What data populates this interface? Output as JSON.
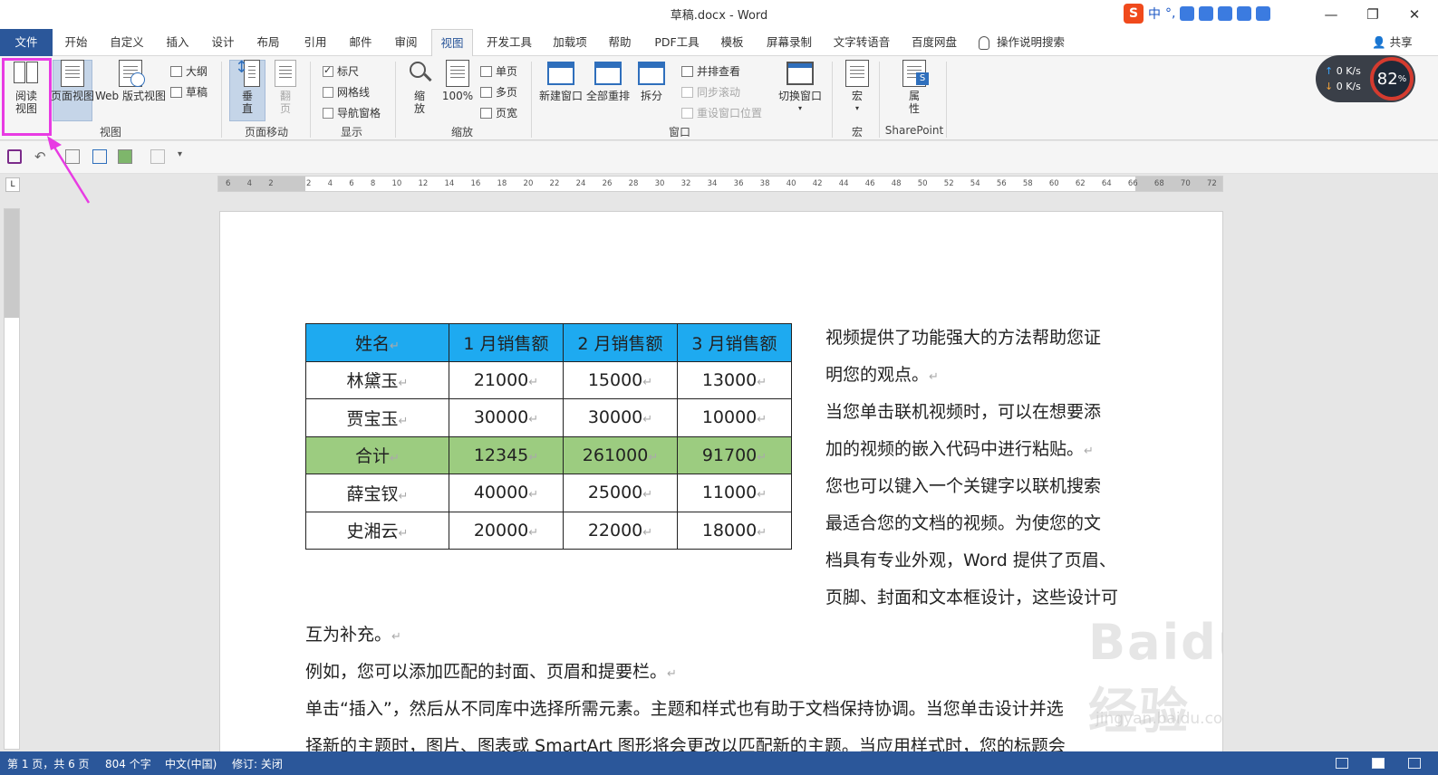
{
  "window": {
    "title": "草稿.docx  -  Word",
    "ime": {
      "logo": "S",
      "lang": "中",
      "punct": "°,"
    },
    "controls": {
      "minimize": "—",
      "restore": "❐",
      "close": "✕"
    }
  },
  "tabs": {
    "file": "文件",
    "items": [
      "开始",
      "自定义",
      "插入",
      "设计",
      "布局",
      "引用",
      "邮件",
      "审阅",
      "视图",
      "开发工具",
      "加载项",
      "帮助",
      "PDF工具",
      "模板",
      "屏幕录制",
      "文字转语音",
      "百度网盘"
    ],
    "search": "操作说明搜索",
    "share": "共享"
  },
  "ribbon": {
    "views": {
      "read_mode": "阅读视图",
      "print_layout": "页面视图",
      "web_layout": "Web 版式视图",
      "outline": "大纲",
      "draft": "草稿",
      "group": "视图"
    },
    "page_movement": {
      "vertical": "垂直",
      "side_to_side": "翻页",
      "group": "页面移动"
    },
    "show": {
      "ruler": "标尺",
      "gridlines": "网格线",
      "navigation": "导航窗格",
      "group": "显示",
      "ruler_checked": true,
      "gridlines_checked": false,
      "navigation_checked": false
    },
    "zoom": {
      "zoom": "缩放",
      "hundred": "100%",
      "one_page": "单页",
      "multiple_pages": "多页",
      "page_width": "页宽",
      "group": "缩放"
    },
    "window": {
      "new_window": "新建窗口",
      "arrange_all": "全部重排",
      "split": "拆分",
      "side_by_side": "并排查看",
      "sync_scroll": "同步滚动",
      "reset_position": "重设窗口位置",
      "switch_windows": "切换窗口",
      "group": "窗口"
    },
    "macros": {
      "macros": "宏",
      "group": "宏"
    },
    "sharepoint": {
      "properties": "属性",
      "group": "SharePoint"
    }
  },
  "speed": {
    "up": "0 K/s",
    "down": "0 K/s",
    "percent": "82",
    "percent_unit": "%"
  },
  "ruler_numbers": [
    "6",
    "4",
    "2",
    "",
    "2",
    "4",
    "6",
    "8",
    "10",
    "12",
    "14",
    "16",
    "18",
    "20",
    "22",
    "24",
    "26",
    "28",
    "30",
    "32",
    "34",
    "36",
    "38",
    "40",
    "42",
    "44",
    "46",
    "48",
    "50",
    "52",
    "54",
    "56",
    "58",
    "60",
    "62",
    "64",
    "66",
    "68",
    "70",
    "72"
  ],
  "ruler_corner": "L",
  "document": {
    "table": {
      "headers": [
        "姓名",
        "1 月销售额",
        "2 月销售额",
        "3 月销售额"
      ],
      "rows": [
        [
          "林黛玉",
          "21000",
          "15000",
          "13000"
        ],
        [
          "贾宝玉",
          "30000",
          "30000",
          "10000"
        ],
        [
          "合计",
          "12345",
          "261000",
          "91700"
        ],
        [
          "薛宝钗",
          "40000",
          "25000",
          "11000"
        ],
        [
          "史湘云",
          "20000",
          "22000",
          "18000"
        ]
      ],
      "total_row_index": 2
    },
    "side_lines": [
      "视频提供了功能强大的方法帮助您证",
      "明您的观点。",
      "当您单击联机视频时，可以在想要添",
      "加的视频的嵌入代码中进行粘贴。",
      "您也可以键入一个关键字以联机搜索",
      "最适合您的文档的视频。为使您的文",
      "档具有专业外观，Word 提供了页眉、",
      "页脚、封面和文本框设计，这些设计可"
    ],
    "body_lines": [
      "互为补充。",
      "例如，您可以添加匹配的封面、页眉和提要栏。",
      "单击“插入”，然后从不同库中选择所需元素。主题和样式也有助于文档保持协调。当您单击设计并选",
      "择新的主题时，图片、图表或 SmartArt 图形将会更改以匹配新的主题。当应用样式时，您的标题会"
    ],
    "paragraph_mark": "↵"
  },
  "watermark": {
    "main": "Baidu经验",
    "sub": "jingyan.baidu.com"
  },
  "status": {
    "page": "第 1 页，共 6 页",
    "words": "804 个字",
    "language": "中文(中国)",
    "track": "修订: 关闭"
  },
  "colors": {
    "file_tab": "#2b579a",
    "header_fill": "#1eaaf0",
    "total_fill": "#9ccc80",
    "highlight": "#e83be3"
  }
}
